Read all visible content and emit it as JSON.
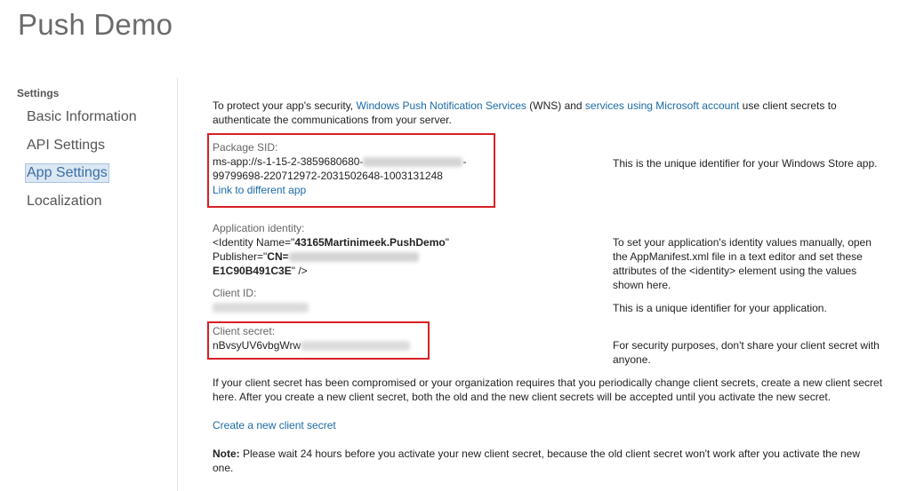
{
  "app": {
    "title": "Push Demo"
  },
  "sidebar": {
    "heading": "Settings",
    "items": [
      {
        "label": "Basic Information",
        "selected": false
      },
      {
        "label": "API Settings",
        "selected": false
      },
      {
        "label": "App Settings",
        "selected": true
      },
      {
        "label": "Localization",
        "selected": false
      }
    ]
  },
  "intro": {
    "text_1": "To protect your app's security, ",
    "link_wns": "Windows Push Notification Services",
    "text_2": " (WNS) and ",
    "link_msa": "services using Microsoft account",
    "text_3": " use client secrets to authenticate the communications from your server."
  },
  "package_sid": {
    "label": "Package SID:",
    "line1_visible": "ms-app://s-1-15-2-3859680680-",
    "line1_suffix": "-",
    "line2": "99799698-220712972-2031502648-1003131248",
    "link": "Link to different app",
    "description": "This is the unique identifier for your Windows Store app."
  },
  "app_identity": {
    "label": "Application identity:",
    "line1_prefix": "<Identity Name=\"",
    "line1_name": "43165Martinimeek.PushDemo",
    "line1_suffix": "\"",
    "line2_prefix": "Publisher=\"",
    "line2_cn": "CN=",
    "line3_value": "E1C90B491C3E",
    "line3_suffix": "\" />",
    "description": "To set your application's identity values manually, open the AppManifest.xml file in a text editor and set these attributes of the <identity> element using the values shown here."
  },
  "client_id": {
    "label": "Client ID:",
    "description": "This is a unique identifier for your application."
  },
  "client_secret": {
    "label": "Client secret:",
    "visible_value": "nBvsyUV6vbgWrw",
    "description": "For security purposes, don't share your client secret with anyone."
  },
  "compromised": {
    "text": "If your client secret has been compromised or your organization requires that you periodically change client secrets, create a new client secret here. After you create a new client secret, both the old and the new client secrets will be accepted until you activate the new secret."
  },
  "create_link": "Create a new client secret",
  "note": {
    "label": "Note:",
    "text": " Please wait 24 hours before you activate your new client secret, because the old client secret won't work after you activate the new one."
  },
  "colors": {
    "link": "#1c6aa6",
    "highlight": "#d81f26",
    "selected_bg": "#dbe7f3"
  }
}
